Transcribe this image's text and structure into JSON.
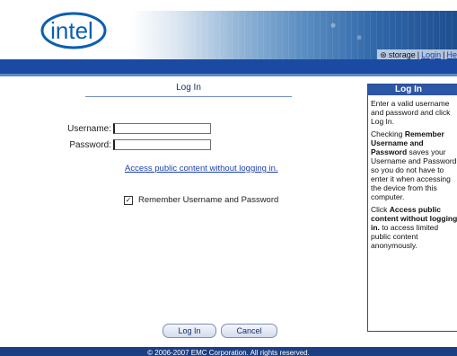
{
  "header": {
    "logo_text": "intel",
    "links": {
      "storage": "storage",
      "sep1": "|",
      "login": "Login",
      "sep2": "|",
      "help": "He"
    }
  },
  "main": {
    "title": "Log In",
    "username_label": "Username:",
    "username_value": "",
    "password_label": "Password:",
    "password_value": "",
    "public_link": "Access public content without logging in.",
    "remember_label": "Remember Username and Password",
    "remember_checked": true,
    "login_button": "Log In",
    "cancel_button": "Cancel"
  },
  "sidebar": {
    "title": "Log In",
    "p1": "Enter a valid username and password and click Log In.",
    "p2_pre": "Checking ",
    "p2_bold": "Remember Username and Password",
    "p2_post": " saves your Username and Password so you do not have to enter it when accessing the device from this computer.",
    "p3_pre": "Click ",
    "p3_bold": "Access public content without logging in.",
    "p3_post": " to access limited public content anonymously."
  },
  "footer": {
    "text": "© 2006-2007 EMC Corporation. All rights reserved."
  },
  "colors": {
    "navy": "#1b4aa2",
    "accent": "#2c56a6",
    "link": "#1a3fa8"
  }
}
